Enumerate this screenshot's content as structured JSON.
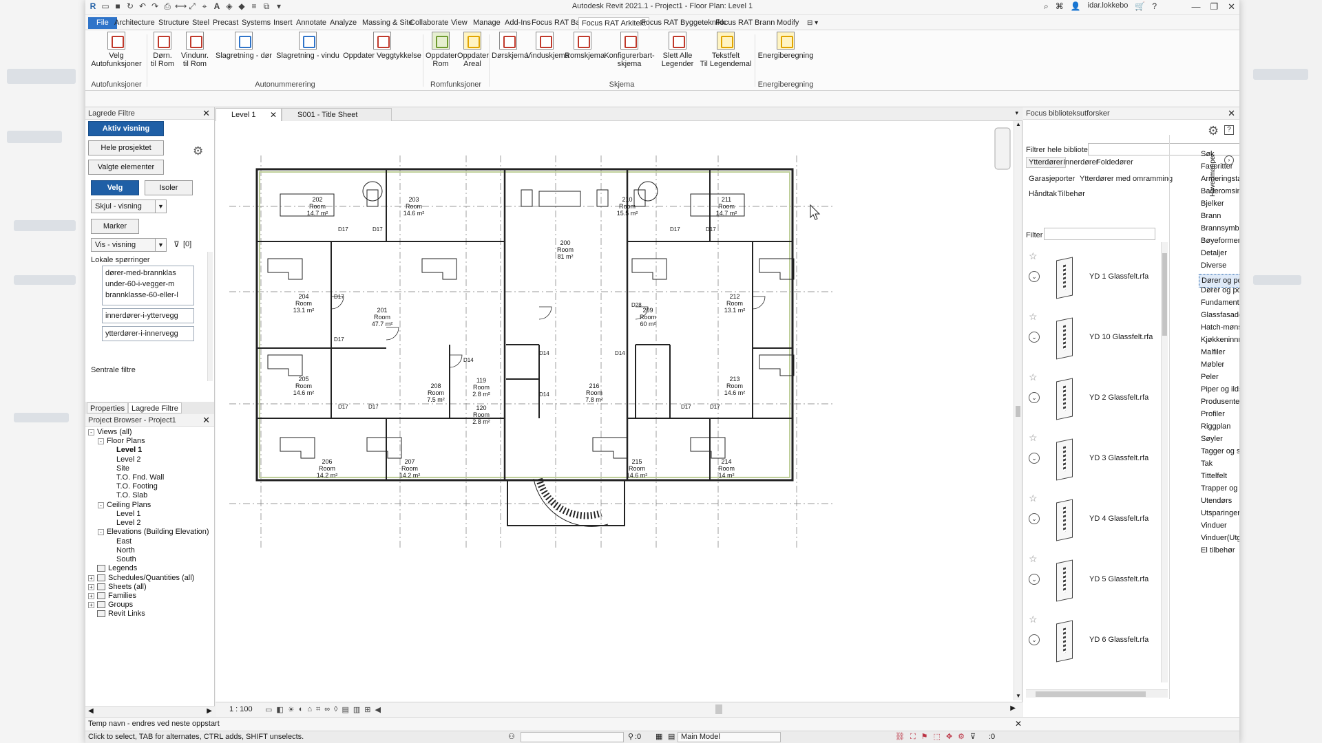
{
  "window": {
    "title": "Autodesk Revit 2021.1 - Project1 - Floor Plan: Level 1",
    "user": "idar.lokkebo"
  },
  "tabs": [
    "File",
    "Architecture",
    "Structure",
    "Steel",
    "Precast",
    "Systems",
    "Insert",
    "Annotate",
    "Analyze",
    "Massing & Site",
    "Collaborate",
    "View",
    "Manage",
    "Add-Ins",
    "Focus RAT Basis",
    "Focus RAT Arkitekt",
    "Focus RAT Byggeteknikk",
    "Focus RAT Brann",
    "Modify"
  ],
  "active_tab": "Focus RAT Arkitekt",
  "ribbon": {
    "buttons": [
      {
        "label": "Velg Autofunksjoner"
      },
      {
        "label": "Dørn.\ntil Rom"
      },
      {
        "label": "Vindunr.\ntil Rom"
      },
      {
        "label": "Slagretning - dør"
      },
      {
        "label": "Slagretning - vindu"
      },
      {
        "label": "Oppdater Veggtykkelse"
      },
      {
        "label": "Oppdater\nRom"
      },
      {
        "label": "Oppdater\nAreal"
      },
      {
        "label": "Dørskjema"
      },
      {
        "label": "Vinduskjema"
      },
      {
        "label": "Romskjema"
      },
      {
        "label": "Konfigurerbart-\nskjema"
      },
      {
        "label": "Slett Alle\nLegender"
      },
      {
        "label": "Tekstfelt\nTil Legendemal"
      },
      {
        "label": "Energiberegning"
      }
    ],
    "panels": [
      "Autofunksjoner",
      "Autonummerering",
      "Romfunksjoner",
      "Skjema",
      "Energiberegning"
    ]
  },
  "saved_filters": {
    "header": "Lagrede Filtre",
    "active_view": "Aktiv visning",
    "whole_project": "Hele prosjektet",
    "selected_elements": "Valgte elementer",
    "select": "Velg",
    "isolate": "Isoler",
    "hide_view": "Skjul - visning",
    "mark": "Marker",
    "show_view": "Vis - visning",
    "filter_count": "[0]",
    "local_queries": "Lokale spørringer",
    "queries": [
      [
        "dører-med-brannklas",
        "under-60-i-vegger-m",
        "brannklasse-60-eller-l"
      ],
      [
        "innerdører-i-yttervegg"
      ],
      [
        "ytterdører-i-innervegg"
      ]
    ],
    "central": "Sentrale filtre"
  },
  "panel_tabs": [
    "Properties",
    "Lagrede Filtre"
  ],
  "project_browser": {
    "header": "Project Browser - Project1",
    "items": [
      {
        "label": "Views (all)",
        "level": 0,
        "exp": "-"
      },
      {
        "label": "Floor Plans",
        "level": 1,
        "exp": "-"
      },
      {
        "label": "Level 1",
        "level": 2,
        "bold": true
      },
      {
        "label": "Level 2",
        "level": 2
      },
      {
        "label": "Site",
        "level": 2
      },
      {
        "label": "T.O. Fnd. Wall",
        "level": 2
      },
      {
        "label": "T.O. Footing",
        "level": 2
      },
      {
        "label": "T.O. Slab",
        "level": 2
      },
      {
        "label": "Ceiling Plans",
        "level": 1,
        "exp": "-"
      },
      {
        "label": "Level 1",
        "level": 2
      },
      {
        "label": "Level 2",
        "level": 2
      },
      {
        "label": "Elevations (Building Elevation)",
        "level": 1,
        "exp": "-"
      },
      {
        "label": "East",
        "level": 2
      },
      {
        "label": "North",
        "level": 2
      },
      {
        "label": "South",
        "level": 2
      },
      {
        "label": "Legends",
        "level": 0,
        "icon": true
      },
      {
        "label": "Schedules/Quantities (all)",
        "level": 0,
        "exp": "+",
        "icon": true
      },
      {
        "label": "Sheets (all)",
        "level": 0,
        "exp": "+",
        "icon": true
      },
      {
        "label": "Families",
        "level": 0,
        "exp": "+",
        "icon": true
      },
      {
        "label": "Groups",
        "level": 0,
        "exp": "+",
        "icon": true
      },
      {
        "label": "Revit Links",
        "level": 0,
        "icon": true
      }
    ]
  },
  "doc_tabs": [
    {
      "label": "Level 1",
      "active": true
    },
    {
      "label": "S001 - Title Sheet",
      "active": false
    }
  ],
  "view_bar": {
    "scale": "1 : 100"
  },
  "floor_plan": {
    "rooms": [
      {
        "num": "202",
        "name": "Room",
        "area": "14.7 m²"
      },
      {
        "num": "203",
        "name": "Room",
        "area": "14.6 m²"
      },
      {
        "num": "210",
        "name": "Room",
        "area": "15.5 m²"
      },
      {
        "num": "211",
        "name": "Room",
        "area": "14.7 m²"
      },
      {
        "num": "200",
        "name": "Room",
        "area": "81 m²"
      },
      {
        "num": "204",
        "name": "Room",
        "area": "13.1 m²"
      },
      {
        "num": "201",
        "name": "Room",
        "area": "47.7 m²"
      },
      {
        "num": "209",
        "name": "Room",
        "area": "60 m²"
      },
      {
        "num": "212",
        "name": "Room",
        "area": "13.1 m²"
      },
      {
        "num": "205",
        "name": "Room",
        "area": "14.6 m²"
      },
      {
        "num": "208",
        "name": "Room",
        "area": "7.5 m²"
      },
      {
        "num": "119",
        "name": "Room",
        "area": "2.8 m²"
      },
      {
        "num": "120",
        "name": "Room",
        "area": "2.8 m²"
      },
      {
        "num": "216",
        "name": "Room",
        "area": "7.8 m²"
      },
      {
        "num": "213",
        "name": "Room",
        "area": "14.6 m²"
      },
      {
        "num": "206",
        "name": "Room",
        "area": "14.2 m²"
      },
      {
        "num": "207",
        "name": "Room",
        "area": "14.2 m²"
      },
      {
        "num": "215",
        "name": "Room",
        "area": "14.6 m²"
      },
      {
        "num": "214",
        "name": "Room",
        "area": "14 m²"
      }
    ],
    "door_tag": "D17",
    "door_tag_alt": "D14",
    "door_tag_d28": "D28"
  },
  "library": {
    "header": "Focus biblioteksutforsker",
    "filter_all": "Filtrer hele biblioteket",
    "filter": "Filter",
    "tabs": [
      "Ytterdører",
      "Innerdører",
      "Foldedører",
      "Garasjeporter",
      "Ytterdører med omramming",
      "Håndtak",
      "Tilbehør"
    ],
    "side_label": "Hovedmapper",
    "items": [
      "YD 1 Glassfelt.rfa",
      "YD 10 Glassfelt.rfa",
      "YD 2 Glassfelt.rfa",
      "YD 3 Glassfelt.rfa",
      "YD 4 Glassfelt.rfa",
      "YD 5 Glassfelt.rfa",
      "YD 6 Glassfelt.rfa"
    ],
    "categories": [
      "Søk",
      "Favoritter",
      "Armeringstagger og -symboler",
      "Baderomsinnredning",
      "Bjelker",
      "Brann",
      "Brannsymboler",
      "Bøyeformer",
      "Detaljer",
      "Diverse",
      "Dører og porter",
      "Dører og porter(Utgående)",
      "Fundamenter",
      "Glassfasadeelementer",
      "Hatch-mønster",
      "Kjøkkeninnredning",
      "Malfiler",
      "Møbler",
      "Peler",
      "Piper og ildsteder",
      "Produsenter",
      "Profiler",
      "Riggplan",
      "Søyler",
      "Tagger og symboler",
      "Tak",
      "Tittelfelt",
      "Trapper og rekkverk",
      "Utendørs",
      "Utsparinger",
      "Vinduer",
      "Vinduer(Utgående)",
      "El tilbehør"
    ],
    "selected_category": "Dører og porter"
  },
  "status": {
    "temp": "Temp navn - endres ved neste oppstart",
    "hint": "Click to select, TAB for alternates, CTRL adds, SHIFT unselects.",
    "model": "Main Model",
    "count": ":0",
    "filter_count": ":0"
  }
}
